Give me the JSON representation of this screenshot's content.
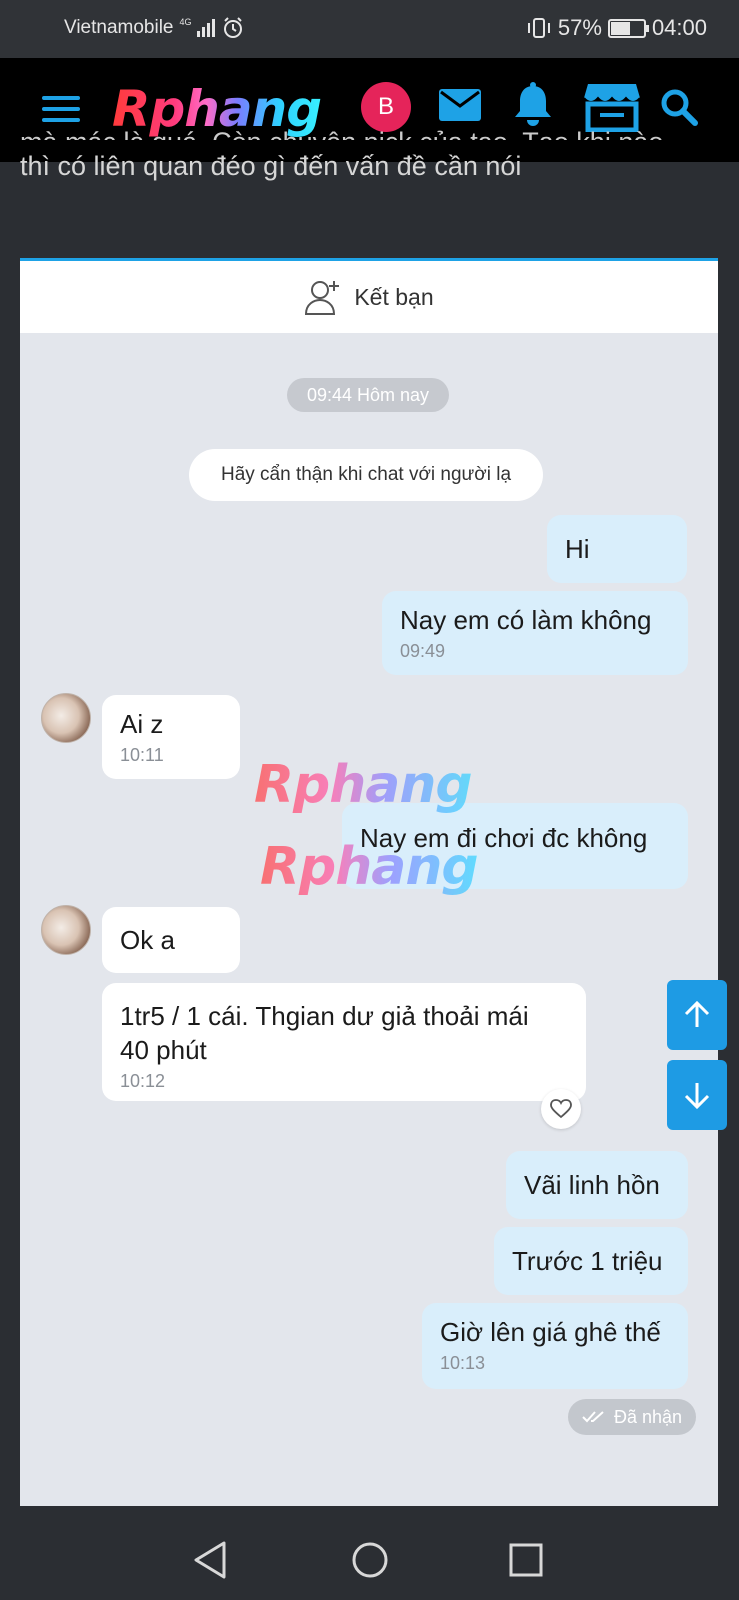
{
  "status_bar": {
    "carrier": "Vietnamobile",
    "network": "4G",
    "battery": "57%",
    "battery_level": 0.57,
    "time": "04:00"
  },
  "header": {
    "logo": "Rphang",
    "user_initial": "B",
    "accent_color": "#1ea2e6",
    "avatar_color": "#e5245a"
  },
  "post": {
    "cut_line": "mà mác là quá. Còn chuyện nick của tao. Tạo khi nào",
    "line2": "thì có liên quan đéo gì đến vấn đề cần nói"
  },
  "chat": {
    "add_friend_label": "Kết bạn",
    "date_pill": "09:44 Hôm nay",
    "warning": "Hãy cẩn thận khi chat với người lạ",
    "messages": [
      {
        "dir": "out",
        "text": "Hi",
        "time": ""
      },
      {
        "dir": "out",
        "text": "Nay em có làm không",
        "time": "09:49"
      },
      {
        "dir": "in",
        "text": "Ai z",
        "time": "10:11"
      },
      {
        "dir": "out",
        "text": "Nay em đi chơi đc không",
        "time": ""
      },
      {
        "dir": "in",
        "text": "Ok a",
        "time": ""
      },
      {
        "dir": "in",
        "text": "1tr5 / 1 cái. Thgian dư giả thoải mái 40 phút",
        "time": "10:12"
      },
      {
        "dir": "out",
        "text": "Vãi linh hồn",
        "time": ""
      },
      {
        "dir": "out",
        "text": "Trước 1 triệu",
        "time": ""
      },
      {
        "dir": "out",
        "text": "Giờ lên giá ghê thế",
        "time": "10:13"
      }
    ],
    "status": "Đã nhận",
    "watermark": "Rphang"
  },
  "icons": {
    "menu": "hamburger-icon",
    "mail": "mail-icon",
    "bell": "bell-icon",
    "store": "store-icon",
    "search": "search-icon",
    "add_friend": "add-user-icon",
    "heart": "heart-icon",
    "arrow_up": "arrow-up-icon",
    "arrow_down": "arrow-down-icon",
    "back": "back-icon",
    "home": "home-icon",
    "recents": "recents-icon"
  }
}
